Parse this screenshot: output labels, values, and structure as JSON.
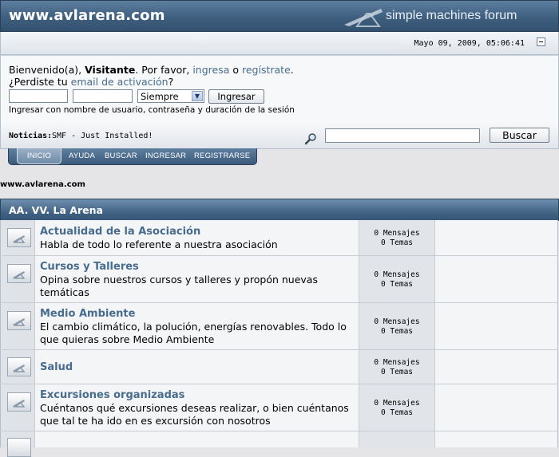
{
  "header": {
    "site_title": "www.avlarena.com",
    "logo_text": "simple machines forum"
  },
  "datebar": {
    "date": "Mayo 09, 2009, 05:06:41"
  },
  "login": {
    "welcome_prefix": "Bienvenido(a), ",
    "guest_name": "Visitante",
    "welcome_mid": ". Por favor, ",
    "login_link": "ingresa",
    "or_text": " o ",
    "register_link": "regístrate",
    "end_dot": ".",
    "forgot_prefix": "¿Perdiste tu ",
    "activation_link": "email de activación",
    "forgot_suffix": "?",
    "duration_value": "Siempre",
    "login_button": "Ingresar",
    "hint": "Ingresar con nombre de usuario, contraseña y duración de la sesión"
  },
  "news": {
    "label": "Noticias:",
    "text": "SMF - Just Installed!",
    "search_button": "Buscar"
  },
  "menu": {
    "tabs": [
      "INICIO",
      "AYUDA",
      "BUSCAR",
      "INGRESAR",
      "REGISTRARSE"
    ]
  },
  "breadcrumb": "www.avlarena.com",
  "category": {
    "title": "AA. VV. La Arena"
  },
  "boards": [
    {
      "name": "Actualidad de la Asociación",
      "desc": "Habla de todo lo referente a nuestra asociación",
      "posts": "0 Mensajes",
      "topics": "0 Temas"
    },
    {
      "name": "Cursos y Talleres",
      "desc": "Opina sobre nuestros cursos y talleres y propón nuevas temáticas",
      "posts": "0 Mensajes",
      "topics": "0 Temas"
    },
    {
      "name": "Medio Ambiente",
      "desc": "El cambio climático, la polución, energías renovables. Todo lo que quieras sobre Medio Ambiente",
      "posts": "0 Mensajes",
      "topics": "0 Temas"
    },
    {
      "name": "Salud",
      "desc": "",
      "posts": "0 Mensajes",
      "topics": "0 Temas"
    },
    {
      "name": "Excursiones organizadas",
      "desc": "Cuéntanos qué excursiones deseas realizar, o bien cuéntanos que tal te ha ido en es excursión con nosotros",
      "posts": "0 Mensajes",
      "topics": "0 Temas"
    }
  ],
  "colors": {
    "header_blue": "#3f5f80",
    "link_blue": "#476c8e",
    "page_bg": "#e5e5e8"
  }
}
